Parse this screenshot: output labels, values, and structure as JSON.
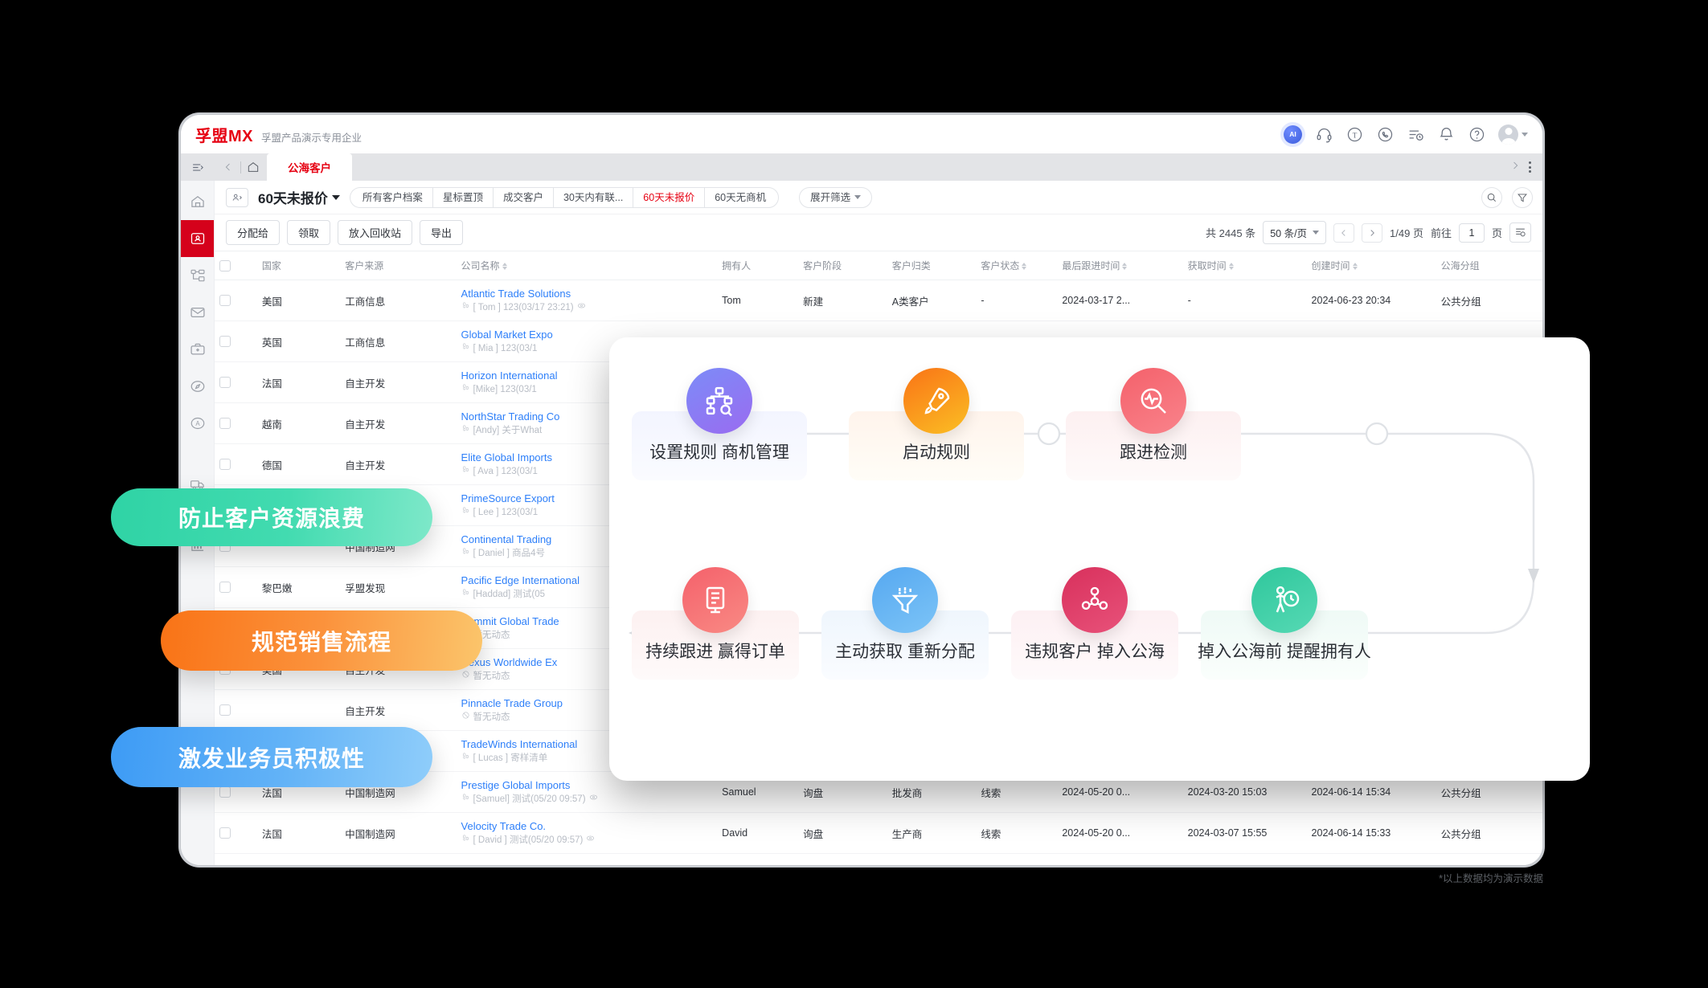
{
  "header": {
    "logo": "孚盟MX",
    "subtitle": "孚盟产品演示专用企业",
    "icons": [
      {
        "name": "ai-assistant-icon",
        "label": "AI"
      },
      {
        "name": "headset-support-icon",
        "label": ""
      },
      {
        "name": "translate-icon",
        "label": "T"
      },
      {
        "name": "whatsapp-icon",
        "label": ""
      },
      {
        "name": "task-history-icon",
        "label": ""
      },
      {
        "name": "notification-bell-icon",
        "label": ""
      },
      {
        "name": "help-circle-icon",
        "label": ""
      }
    ]
  },
  "tabstrip": {
    "active_tab": "公海客户"
  },
  "rail": {
    "items": [
      {
        "name": "home",
        "icon": "home-icon",
        "active": false
      },
      {
        "name": "customers",
        "icon": "user-card-icon",
        "active": true
      },
      {
        "name": "org",
        "icon": "sitemap-icon",
        "active": false
      },
      {
        "name": "mail",
        "icon": "envelope-icon",
        "active": false
      },
      {
        "name": "orders",
        "icon": "briefcase-icon",
        "active": false
      },
      {
        "name": "discover",
        "icon": "compass-icon",
        "active": false
      },
      {
        "name": "alphabet",
        "icon": "letter-a-icon",
        "active": false
      },
      {
        "name": "logistics",
        "icon": "truck-icon",
        "active": false
      },
      {
        "name": "reports",
        "icon": "bar-chart-icon",
        "active": false
      },
      {
        "name": "settings",
        "icon": "hexagon-gear-icon",
        "active": false
      }
    ]
  },
  "filterbar": {
    "view_title": "60天未报价",
    "chips": [
      {
        "label": "所有客户档案",
        "active": false
      },
      {
        "label": "星标置顶",
        "active": false
      },
      {
        "label": "成交客户",
        "active": false
      },
      {
        "label": "30天内有联...",
        "active": false
      },
      {
        "label": "60天未报价",
        "active": true
      },
      {
        "label": "60天无商机",
        "active": false
      }
    ],
    "expand_filter": "展开筛选",
    "search_icon": "search-icon",
    "funnel_icon": "funnel-icon"
  },
  "actionbar": {
    "buttons": [
      "分配给",
      "领取",
      "放入回收站",
      "导出"
    ],
    "total_label": "共 2445 条",
    "page_size": "50 条/页",
    "page_indicator": "1/49 页",
    "goto_label": "前往",
    "goto_value": "1",
    "page_unit": "页"
  },
  "table": {
    "columns": [
      {
        "label": "国家",
        "sortable": false
      },
      {
        "label": "客户来源",
        "sortable": false
      },
      {
        "label": "公司名称",
        "sortable": true
      },
      {
        "label": "拥有人",
        "sortable": false
      },
      {
        "label": "客户阶段",
        "sortable": false
      },
      {
        "label": "客户归类",
        "sortable": false
      },
      {
        "label": "客户状态",
        "sortable": true
      },
      {
        "label": "最后跟进时间",
        "sortable": true
      },
      {
        "label": "获取时间",
        "sortable": true
      },
      {
        "label": "创建时间",
        "sortable": true
      },
      {
        "label": "公海分组",
        "sortable": false
      }
    ],
    "rows": [
      {
        "country": "美国",
        "source": "工商信息",
        "company": "Atlantic Trade Solutions",
        "note": "[ Tom ] 123(03/17 23:21)",
        "note_icon": "footprint-icon",
        "has_eye": true,
        "owner": "Tom",
        "stage": "新建",
        "category": "A类客户",
        "state": "-",
        "last_follow": "2024-03-17 2...",
        "acquired": "-",
        "created": "2024-06-23 20:34",
        "group": "公共分组"
      },
      {
        "country": "英国",
        "source": "工商信息",
        "company": "Global Market Expo",
        "note": "[ Mia ] 123(03/1",
        "note_icon": "footprint-icon",
        "has_eye": false,
        "owner": "",
        "stage": "",
        "category": "",
        "state": "",
        "last_follow": "",
        "acquired": "",
        "created": "",
        "group": ""
      },
      {
        "country": "法国",
        "source": "自主开发",
        "company": "Horizon International",
        "note": "[Mike] 123(03/1",
        "note_icon": "footprint-icon",
        "has_eye": false,
        "owner": "",
        "stage": "",
        "category": "",
        "state": "",
        "last_follow": "",
        "acquired": "",
        "created": "",
        "group": ""
      },
      {
        "country": "越南",
        "source": "自主开发",
        "company": "NorthStar Trading Co",
        "note": "[Andy] 关于What",
        "note_icon": "footprint-icon",
        "has_eye": false,
        "owner": "",
        "stage": "",
        "category": "",
        "state": "",
        "last_follow": "",
        "acquired": "",
        "created": "",
        "group": ""
      },
      {
        "country": "德国",
        "source": "自主开发",
        "company": "Elite Global Imports",
        "note": "[ Ava ] 123(03/1",
        "note_icon": "footprint-icon",
        "has_eye": false,
        "owner": "",
        "stage": "",
        "category": "",
        "state": "",
        "last_follow": "",
        "acquired": "",
        "created": "",
        "group": ""
      },
      {
        "country": "",
        "source": "",
        "company": "PrimeSource Export",
        "note": "[ Lee ] 123(03/1",
        "note_icon": "footprint-icon",
        "has_eye": false,
        "owner": "",
        "stage": "",
        "category": "",
        "state": "",
        "last_follow": "",
        "acquired": "",
        "created": "",
        "group": ""
      },
      {
        "country": "",
        "source": "中国制造网",
        "company": "Continental Trading",
        "note": "[ Daniel ] 商品4号",
        "note_icon": "footprint-icon",
        "has_eye": false,
        "owner": "",
        "stage": "",
        "category": "",
        "state": "",
        "last_follow": "",
        "acquired": "",
        "created": "",
        "group": ""
      },
      {
        "country": "黎巴嫩",
        "source": "孚盟发现",
        "company": "Pacific Edge International",
        "note": "[Haddad] 测试(05",
        "note_icon": "footprint-icon",
        "has_eye": false,
        "owner": "",
        "stage": "",
        "category": "",
        "state": "",
        "last_follow": "",
        "acquired": "",
        "created": "",
        "group": ""
      },
      {
        "country": "",
        "source": "",
        "company": "Summit Global Trade",
        "note": "暂无动态",
        "note_icon": "no-data-icon",
        "has_eye": false,
        "owner": "",
        "stage": "",
        "category": "",
        "state": "",
        "last_follow": "",
        "acquired": "",
        "created": "",
        "group": ""
      },
      {
        "country": "美国",
        "source": "自主开发",
        "company": "Nexus Worldwide Ex",
        "note": "暂无动态",
        "note_icon": "no-data-icon",
        "has_eye": false,
        "owner": "",
        "stage": "",
        "category": "",
        "state": "",
        "last_follow": "",
        "acquired": "",
        "created": "",
        "group": ""
      },
      {
        "country": "",
        "source": "自主开发",
        "company": "Pinnacle Trade Group",
        "note": "暂无动态",
        "note_icon": "no-data-icon",
        "has_eye": false,
        "owner": "",
        "stage": "",
        "category": "",
        "state": "",
        "last_follow": "",
        "acquired": "",
        "created": "",
        "group": ""
      },
      {
        "country": "",
        "source": "",
        "company": "TradeWinds International",
        "note": "[ Lucas ] 寄样清单",
        "note_icon": "footprint-icon",
        "has_eye": false,
        "owner": "",
        "stage": "",
        "category": "",
        "state": "",
        "last_follow": "",
        "acquired": "",
        "created": "",
        "group": ""
      },
      {
        "country": "法国",
        "source": "中国制造网",
        "company": "Prestige Global Imports",
        "note": "[Samuel] 测试(05/20 09:57)",
        "note_icon": "footprint-icon",
        "has_eye": true,
        "owner": "Samuel",
        "stage": "询盘",
        "category": "批发商",
        "state": "线索",
        "last_follow": "2024-05-20 0...",
        "acquired": "2024-03-20 15:03",
        "created": "2024-06-14 15:34",
        "group": "公共分组"
      },
      {
        "country": "法国",
        "source": "中国制造网",
        "company": "Velocity Trade Co.",
        "note": "[ David ] 测试(05/20 09:57)",
        "note_icon": "footprint-icon",
        "has_eye": true,
        "owner": "David",
        "stage": "询盘",
        "category": "生产商",
        "state": "线索",
        "last_follow": "2024-05-20 0...",
        "acquired": "2024-03-07 15:55",
        "created": "2024-06-14 15:33",
        "group": "公共分组"
      }
    ]
  },
  "pills": [
    {
      "text": "防止客户资源浪费",
      "color": "#2fd3a5"
    },
    {
      "text": "规范销售流程",
      "color": "#f97316"
    },
    {
      "text": "激发业务员积极性",
      "color": "#3d9bf5"
    }
  ],
  "flow": {
    "top": [
      {
        "label": "设置规则 商机管理",
        "icon": "sitemap-search-icon",
        "badge_from": "#7c8cf8",
        "badge_to": "#9a6bf0",
        "box_from": "#f3f5ff",
        "box_to": "#fafbff"
      },
      {
        "label": "启动规则",
        "icon": "rocket-icon",
        "badge_from": "#f97316",
        "badge_to": "#fbbf24",
        "box_from": "#fff4ec",
        "box_to": "#fffdf7"
      },
      {
        "label": "跟进检测",
        "icon": "pulse-search-icon",
        "badge_from": "#f4616b",
        "badge_to": "#f9838b",
        "box_from": "#fdf0f1",
        "box_to": "#fefafa"
      }
    ],
    "bottom": [
      {
        "label": "持续跟进 赢得订单",
        "icon": "document-list-icon",
        "badge_from": "#f4616b",
        "badge_to": "#f98a84",
        "box_from": "#fdf1f1",
        "box_to": "#fefafa"
      },
      {
        "label": "主动获取 重新分配",
        "icon": "funnel-data-icon",
        "badge_from": "#56a8f0",
        "badge_to": "#7cc4f7",
        "box_from": "#eff6fd",
        "box_to": "#fafcff"
      },
      {
        "label": "违规客户 掉入公海",
        "icon": "users-network-icon",
        "badge_from": "#d8305c",
        "badge_to": "#e8527a",
        "box_from": "#fdf0f3",
        "box_to": "#fefafb"
      },
      {
        "label": "掉入公海前 提醒拥有人",
        "icon": "person-clock-icon",
        "badge_from": "#2fc79c",
        "badge_to": "#56d9b4",
        "box_from": "#effaf6",
        "box_to": "#fafefc"
      }
    ]
  },
  "watermark": "*以上数据均为演示数据"
}
